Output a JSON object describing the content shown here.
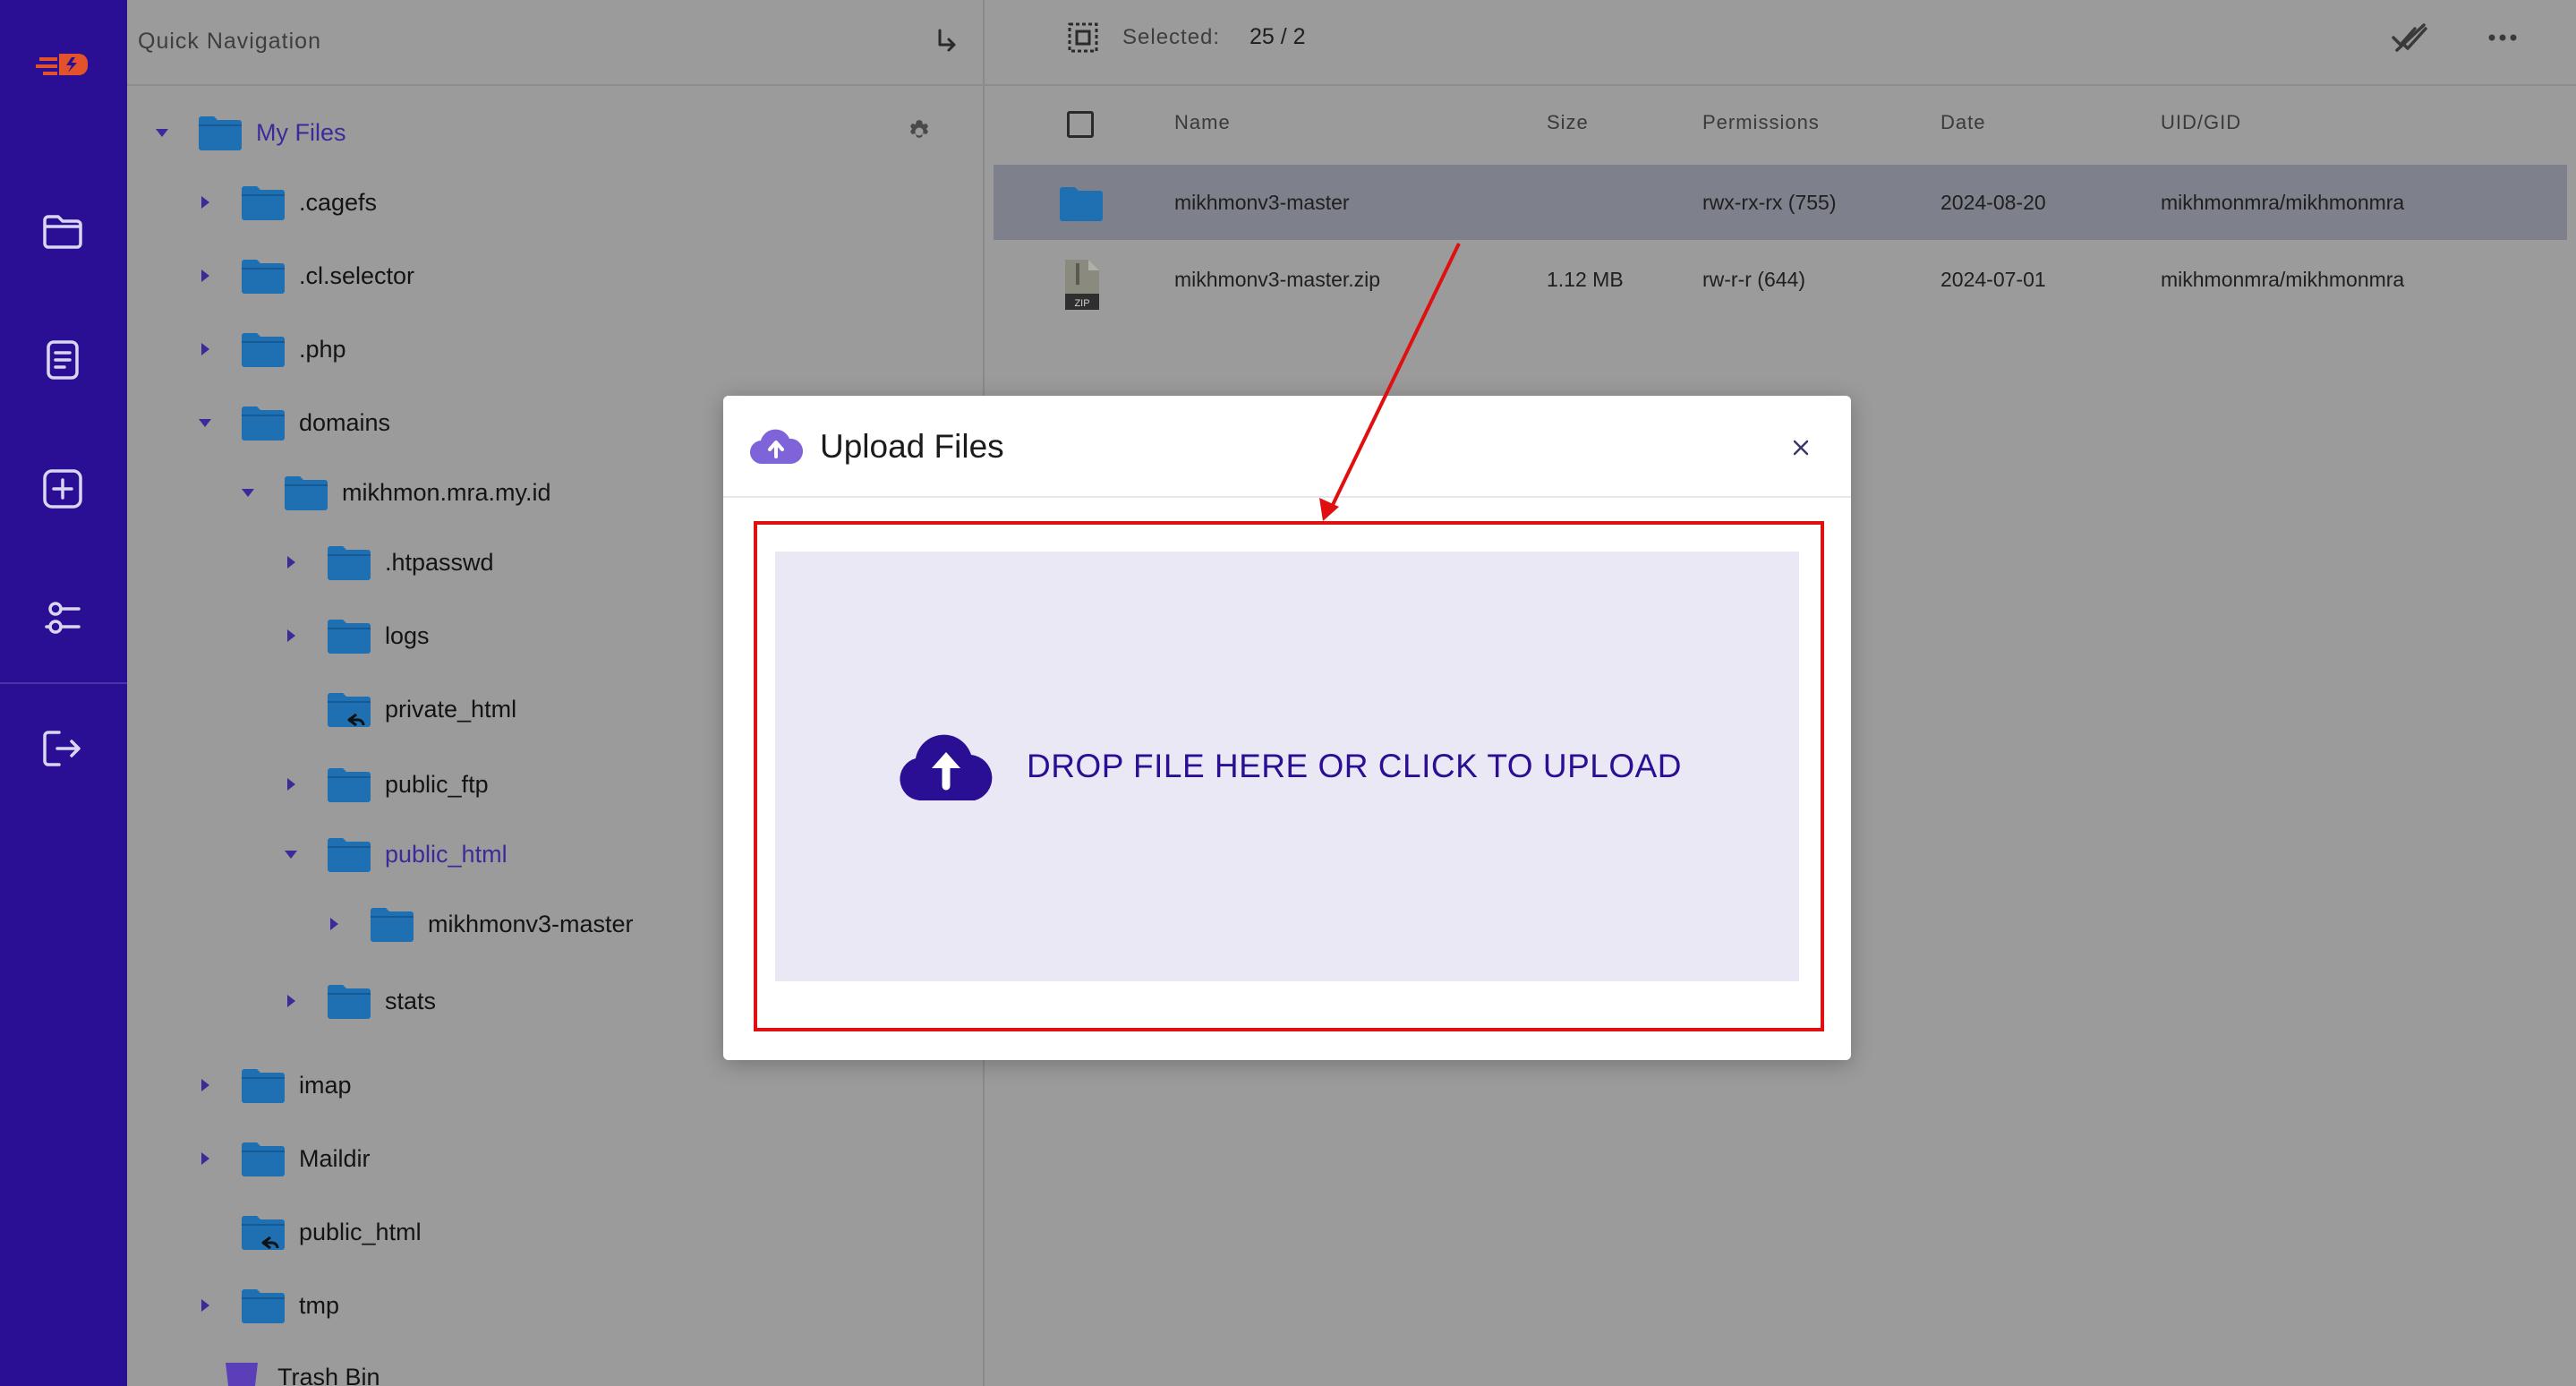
{
  "rail": {
    "items": [
      "folder-icon",
      "document-icon",
      "add-icon",
      "settings-sliders-icon",
      "logout-icon"
    ]
  },
  "nav": {
    "title": "Quick Navigation",
    "root_label": "My Files",
    "tree": [
      {
        "label": ".cagefs",
        "caret": "right"
      },
      {
        "label": ".cl.selector",
        "caret": "right"
      },
      {
        "label": ".php",
        "caret": "right"
      },
      {
        "label": "domains",
        "caret": "down"
      },
      {
        "label": "mikhmon.mra.my.id",
        "caret": "down"
      },
      {
        "label": ".htpasswd",
        "caret": "right"
      },
      {
        "label": "logs",
        "caret": "right"
      },
      {
        "label": "private_html",
        "caret": "none",
        "link": true
      },
      {
        "label": "public_ftp",
        "caret": "right"
      },
      {
        "label": "public_html",
        "caret": "down",
        "active": true
      },
      {
        "label": "mikhmonv3-master",
        "caret": "right"
      },
      {
        "label": "stats",
        "caret": "right"
      },
      {
        "label": "imap",
        "caret": "right"
      },
      {
        "label": "Maildir",
        "caret": "right"
      },
      {
        "label": "public_html",
        "caret": "none",
        "link": true
      },
      {
        "label": "tmp",
        "caret": "right"
      },
      {
        "label": "Trash Bin",
        "caret": "none"
      }
    ]
  },
  "toolbar": {
    "selected_label": "Selected:",
    "selected_count": "25 / 2"
  },
  "table": {
    "headers": [
      "Name",
      "Size",
      "Permissions",
      "Date",
      "UID/GID"
    ],
    "rows": [
      {
        "name": "mikhmonv3-master",
        "size": "",
        "permissions": "rwx-rx-rx (755)",
        "date": "2024-08-20",
        "uid": "mikhmonmra/mikhmonmra",
        "type": "folder"
      },
      {
        "name": "mikhmonv3-master.zip",
        "size": "1.12 MB",
        "permissions": "rw-r-r (644)",
        "date": "2024-07-01",
        "uid": "mikhmonmra/mikhmonmra",
        "type": "zip"
      }
    ]
  },
  "modal": {
    "title": "Upload Files",
    "dropzone_text": "DROP FILE HERE OR CLICK TO UPLOAD",
    "zip_badge": "ZIP"
  },
  "colors": {
    "rail": "#2a0e93",
    "accent": "#2a0e93",
    "folder": "#1f6fb3",
    "dropzone_bg": "#ebe8f5",
    "annotation": "#e01010"
  }
}
